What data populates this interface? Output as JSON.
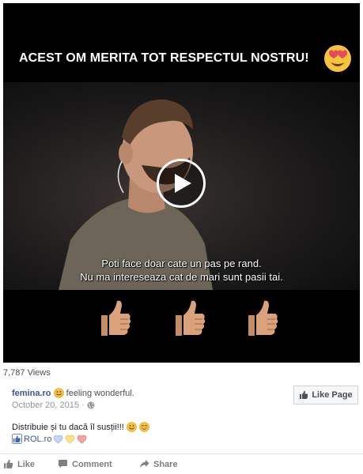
{
  "video": {
    "banner_text": "ACEST OM MERITA TOT RESPECTUL NOSTRU!",
    "banner_emoji": "heart-eyes-emoji",
    "subtitle_line1": "Poti face doar cate un pas pe rand.",
    "subtitle_line2": "Nu ma intereseaza cat de mari sunt pasii tai.",
    "thumbs_up_count": 3,
    "play_icon": "play-icon"
  },
  "stats": {
    "views": "7,787 Views"
  },
  "post": {
    "author": "femina.ro",
    "feeling": "feeling wonderful.",
    "date": "October 20, 2015",
    "date_separator": "·",
    "text": "Distribuie și tu dacă îl susții!!!",
    "tag_name": "ROL.ro",
    "like_page_label": "Like Page"
  },
  "actions": {
    "like": "Like",
    "comment": "Comment",
    "share": "Share"
  },
  "colors": {
    "link_blue": "#365899",
    "meta_gray": "#90949c",
    "action_gray": "#7f7f7f",
    "emoji_yellow": "#f6c33c",
    "thumb_skin": "#d9a27a"
  }
}
